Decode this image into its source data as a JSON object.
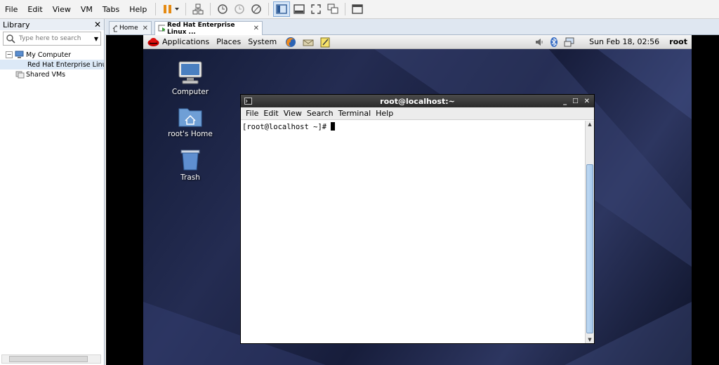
{
  "host_menu": [
    "File",
    "Edit",
    "View",
    "VM",
    "Tabs",
    "Help"
  ],
  "library": {
    "title": "Library",
    "search_placeholder": "Type here to search",
    "tree": [
      {
        "label": "My Computer"
      },
      {
        "label": "Red Hat Enterprise Linu"
      },
      {
        "label": "Shared VMs"
      }
    ]
  },
  "tabs": [
    {
      "label": "Home"
    },
    {
      "label": "Red Hat Enterprise Linux ..."
    }
  ],
  "guest_panel": {
    "menus": [
      "Applications",
      "Places",
      "System"
    ],
    "clock": "Sun Feb 18, 02:56",
    "user": "root"
  },
  "desktop_icons": [
    {
      "label": "Computer"
    },
    {
      "label": "root's Home"
    },
    {
      "label": "Trash"
    }
  ],
  "terminal": {
    "title": "root@localhost:~",
    "menu": [
      "File",
      "Edit",
      "View",
      "Search",
      "Terminal",
      "Help"
    ],
    "prompt": "[root@localhost ~]# "
  },
  "colors": {
    "accent": "#4c83c4",
    "pause": "#e58a12",
    "titlebar": "#333333"
  }
}
